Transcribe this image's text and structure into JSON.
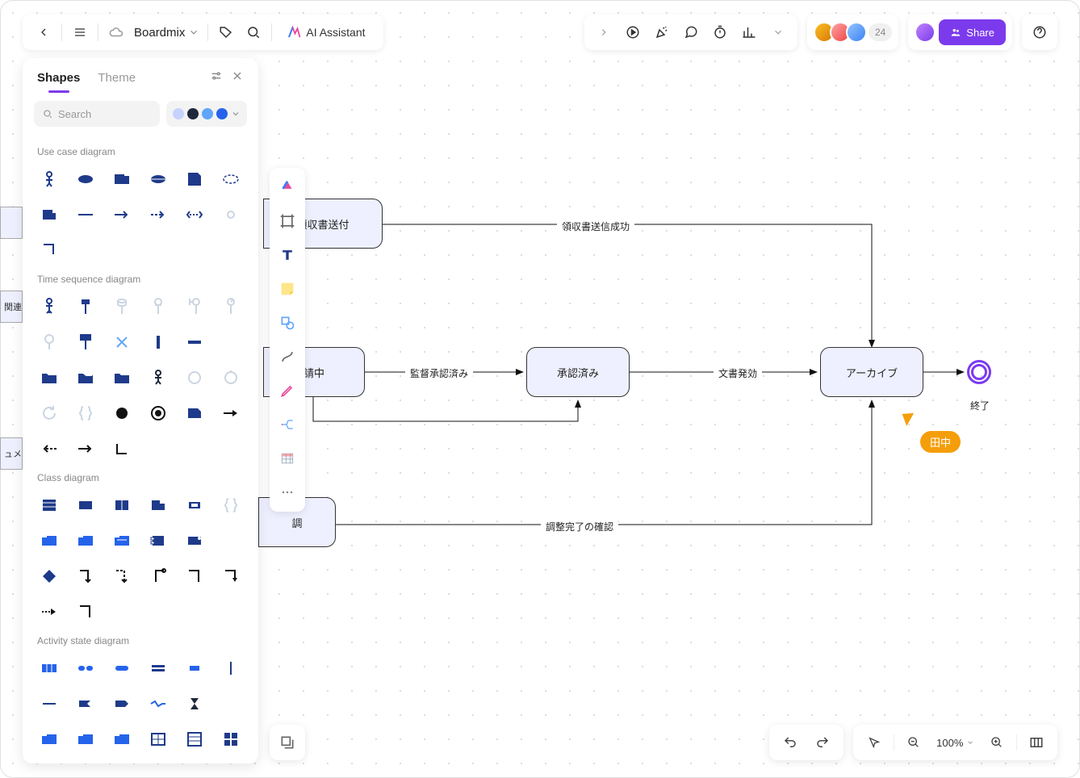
{
  "header": {
    "doc_title": "Boardmix",
    "ai_button": "AI Assistant",
    "avatar_extra_count": "24",
    "share_label": "Share"
  },
  "shapes_panel": {
    "tabs": {
      "shapes": "Shapes",
      "theme": "Theme"
    },
    "search_placeholder": "Search",
    "colors": [
      "#c7d2fe",
      "#1e293b",
      "#60a5fa",
      "#2563eb"
    ],
    "sections": {
      "use_case": "Use case diagram",
      "time_seq": "Time sequence diagram",
      "class": "Class diagram",
      "activity": "Activity state diagram"
    }
  },
  "zoom": {
    "value": "100%"
  },
  "diagram": {
    "nodes": {
      "receipt_send": "領収書送付",
      "requesting": "請中",
      "approved": "承認済み",
      "archive": "アーカイブ",
      "adjust": "調",
      "end_label": "終了"
    },
    "edges": {
      "receipt_success": "領収書送信成功",
      "supervisor_approved": "監督承認済み",
      "doc_issued": "文書発効",
      "adjust_confirm": "調整完了の確認"
    },
    "cursor_user": "田中",
    "lane_label": "関連",
    "lane_label2": "ュメ"
  }
}
